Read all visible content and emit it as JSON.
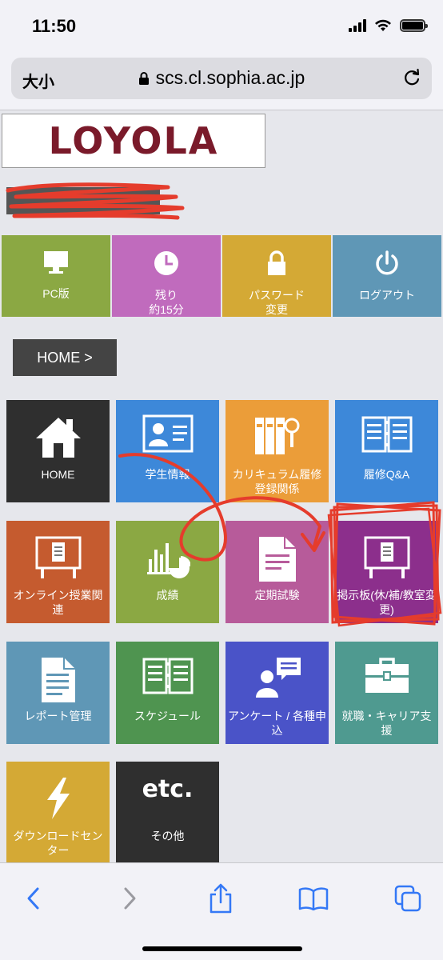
{
  "status": {
    "time": "11:50"
  },
  "browser": {
    "text_size_label": "大小",
    "url": "scs.cl.sophia.ac.jp"
  },
  "site": {
    "logo": "LOYOLA"
  },
  "quick_actions": [
    {
      "label": "PC版",
      "color": "#8ba843",
      "icon": "monitor-icon"
    },
    {
      "label": "残り\n約15分",
      "color": "#c06bbd",
      "icon": "clock-icon"
    },
    {
      "label": "パスワード\n変更",
      "color": "#d4a935",
      "icon": "lock-icon"
    },
    {
      "label": "ログアウト",
      "color": "#5f97b6",
      "icon": "power-icon"
    }
  ],
  "breadcrumb": {
    "label": "HOME >"
  },
  "tiles": [
    {
      "label": "HOME",
      "color": "#2f2f2f",
      "icon": "house-icon"
    },
    {
      "label": "学生情報",
      "color": "#3d88d9",
      "icon": "id-card-icon"
    },
    {
      "label": "カリキュラム履修登録関係",
      "color": "#eb9d39",
      "icon": "binders-icon"
    },
    {
      "label": "履修Q&A",
      "color": "#3d88d9",
      "icon": "open-book-icon"
    },
    {
      "label": "オンライン授業関連",
      "color": "#c55b2f",
      "icon": "notice-board-icon"
    },
    {
      "label": "成績",
      "color": "#8ba843",
      "icon": "chart-icon"
    },
    {
      "label": "定期試験",
      "color": "#b75b9a",
      "icon": "exam-paper-icon"
    },
    {
      "label": "掲示板(休/補/教室変更)",
      "color": "#8c2f8c",
      "icon": "notice-board-icon"
    },
    {
      "label": "レポート管理",
      "color": "#5f97b6",
      "icon": "report-icon"
    },
    {
      "label": "スケジュール",
      "color": "#4f9450",
      "icon": "schedule-book-icon"
    },
    {
      "label": "アンケート / 各種申込",
      "color": "#4a53c8",
      "icon": "survey-icon"
    },
    {
      "label": "就職・キャリア支援",
      "color": "#4f9a90",
      "icon": "briefcase-icon"
    },
    {
      "label": "ダウンロードセンター",
      "color": "#d4a935",
      "icon": "lightning-icon"
    },
    {
      "label": "その他",
      "color": "#2f2f2f",
      "icon": "etc-icon",
      "icon_text": "etc."
    }
  ],
  "annotation_color": "#e53c2c"
}
